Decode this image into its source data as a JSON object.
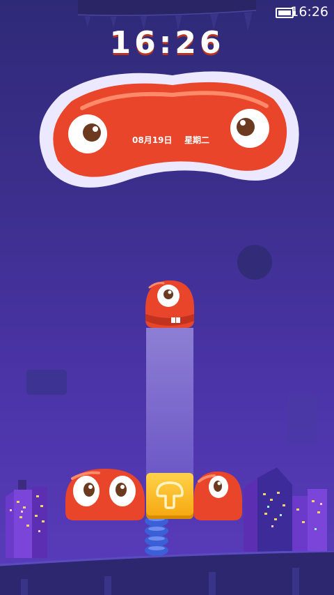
{
  "status_bar": {
    "time": "16:26",
    "battery_icon": "battery-icon"
  },
  "clock": {
    "time": "16:26",
    "date": "08月19日",
    "weekday": "星期二"
  },
  "colors": {
    "background_top": "#2f2a78",
    "background_bottom": "#5a3cbb",
    "monster_red": "#e8452a",
    "badge_outline": "#ece8ff",
    "tile_yellow": "#f5b41a",
    "window_light": "#f2d56a"
  },
  "icons": {
    "unlock": "mushroom-arrow-icon",
    "eye": "eye-icon"
  }
}
